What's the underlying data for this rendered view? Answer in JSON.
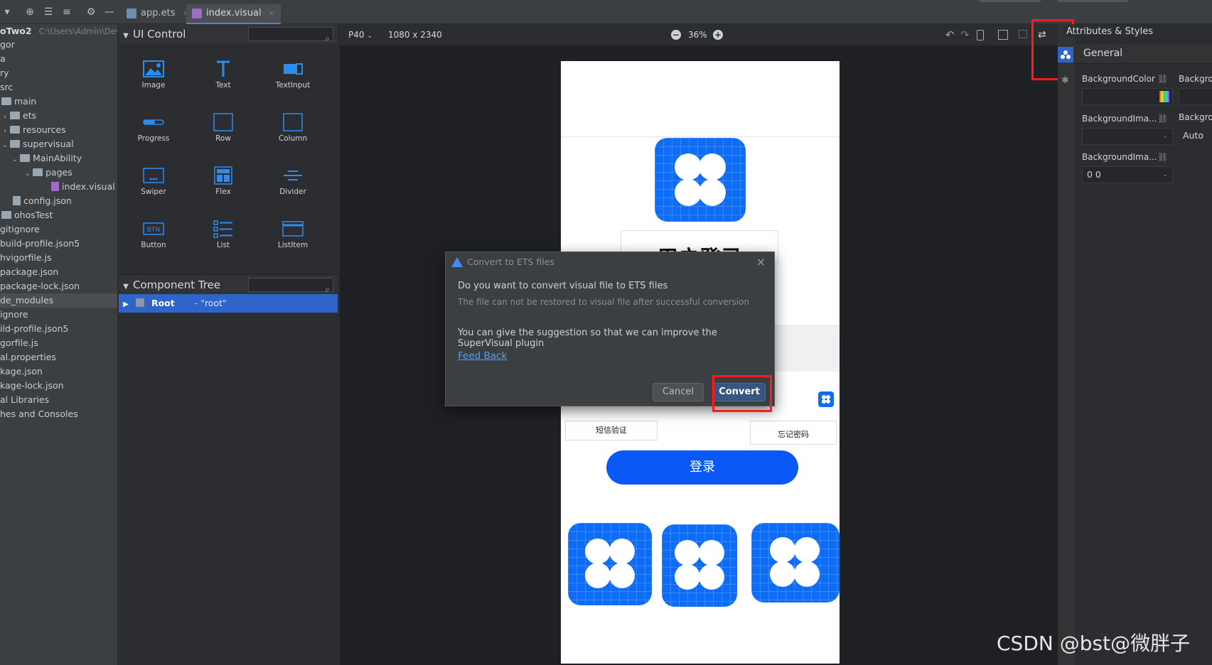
{
  "tabs": [
    {
      "label": "app.ets",
      "close": "×"
    },
    {
      "label": "index.visual",
      "close": "×"
    }
  ],
  "project": {
    "root_label": "oTwo2",
    "root_path": "C:\\Users\\Admin\\DevE",
    "items": [
      {
        "label": "gor"
      },
      {
        "label": "a"
      },
      {
        "label": "ry"
      },
      {
        "label": "src"
      },
      {
        "label": "main"
      },
      {
        "label": "ets"
      },
      {
        "label": "resources"
      },
      {
        "label": "supervisual"
      },
      {
        "label": "MainAbility"
      },
      {
        "label": "pages"
      },
      {
        "label": "index.visual"
      },
      {
        "label": "config.json"
      },
      {
        "label": "ohosTest"
      },
      {
        "label": "gitignore"
      },
      {
        "label": "build-profile.json5"
      },
      {
        "label": "hvigorfile.js"
      },
      {
        "label": "package.json"
      },
      {
        "label": "package-lock.json"
      },
      {
        "label": "de_modules"
      },
      {
        "label": "ignore"
      },
      {
        "label": "ild-profile.json5"
      },
      {
        "label": "gorfile.js"
      },
      {
        "label": "al.properties"
      },
      {
        "label": "kage.json"
      },
      {
        "label": "kage-lock.json"
      },
      {
        "label": "al Libraries"
      },
      {
        "label": "hes and Consoles"
      }
    ]
  },
  "ui_control": {
    "title": "UI Control",
    "controls": [
      {
        "label": "Image"
      },
      {
        "label": "Text"
      },
      {
        "label": "TextInput"
      },
      {
        "label": "Progress"
      },
      {
        "label": "Row"
      },
      {
        "label": "Column"
      },
      {
        "label": "Swiper"
      },
      {
        "label": "Flex"
      },
      {
        "label": "Divider"
      },
      {
        "label": "Button"
      },
      {
        "label": "List"
      },
      {
        "label": "ListItem"
      }
    ]
  },
  "component_tree": {
    "title": "Component Tree",
    "root_label": "Root",
    "root_id": "- \"root\""
  },
  "canvas": {
    "device": "P40",
    "resolution": "1080 x 2340",
    "zoom": "36%",
    "zoom_minus": "−",
    "zoom_plus": "+"
  },
  "phone": {
    "title_partial": "用户登录",
    "sms_button": "短信验证",
    "forgot_button": "忘记密码",
    "login_button": "登录"
  },
  "dialog": {
    "title": "Convert to ETS files",
    "message": "Do you want to convert visual file to ETS files",
    "warning": "The file can not be restored to visual file after successful conversion",
    "suggestion": "You can give the suggestion so that we can improve the SuperVisual plugin",
    "feedback_link": "Feed Back",
    "cancel": "Cancel",
    "convert": "Convert",
    "close": "×"
  },
  "attributes": {
    "title": "Attributes & Styles",
    "section": "General",
    "bg_color_label": "BackgroundColor",
    "bg_color_label2": "Backgrou",
    "bg_image_label": "BackgroundIma...",
    "bg_image_label2": "Backgrou",
    "bg_size_value": "Auto",
    "bg_pos_label": "BackgroundIma...",
    "bg_pos_value": "0 0"
  },
  "watermark": "CSDN @bst@微胖子",
  "colors": {
    "accent_blue": "#0a59f7",
    "highlight_red": "#ff1b1b",
    "selection": "#2f65ca"
  }
}
